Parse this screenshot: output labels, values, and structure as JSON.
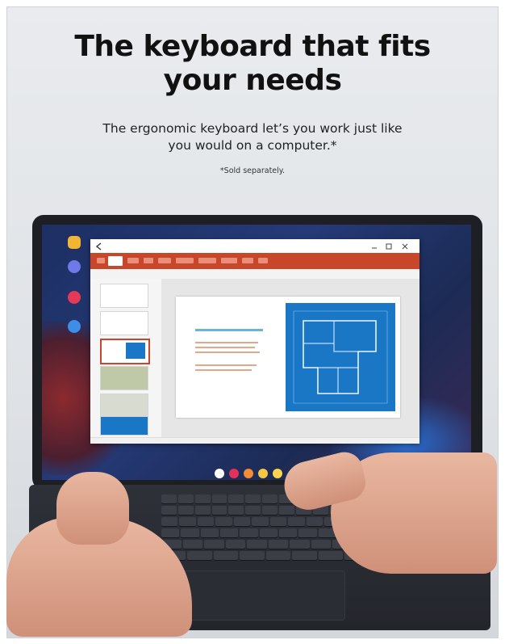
{
  "headline": {
    "line1": "The keyboard that fits",
    "line2": "your needs"
  },
  "subheadline": {
    "line1": "The ergonomic keyboard let’s you work just like",
    "line2": "you would on a computer.*"
  },
  "footnote": "*Sold separately.",
  "colors": {
    "ribbon": "#c8472b",
    "blueprint": "#1a77c6",
    "keyboard": "#2e3138",
    "background": "#e9ebee"
  },
  "icons": [
    "back-arrow-icon",
    "minimize-icon",
    "maximize-icon",
    "close-icon",
    "home-icon",
    "recents-icon",
    "back-icon"
  ]
}
